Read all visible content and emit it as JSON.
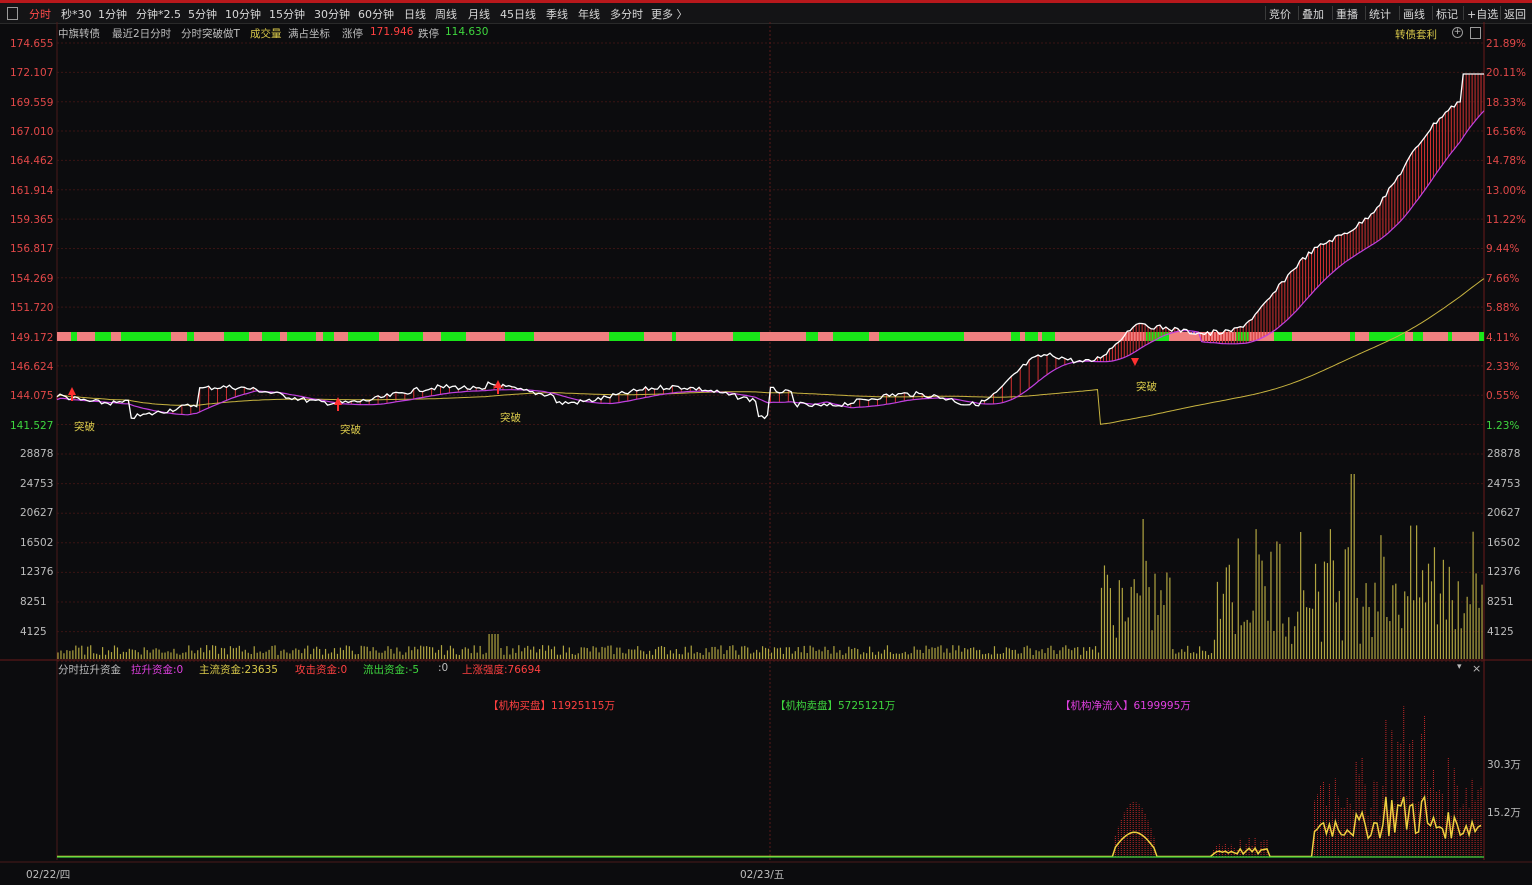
{
  "toolbar": {
    "left_tabs": [
      "分时",
      "秒*30",
      "1分钟",
      "分钟*2.5",
      "5分钟",
      "10分钟",
      "15分钟",
      "30分钟",
      "60分钟",
      "日线",
      "周线",
      "月线",
      "45日线",
      "季线",
      "年线",
      "多分时",
      "更多 〉"
    ],
    "right_tabs": [
      "竞价",
      "叠加",
      "重播",
      "统计",
      "画线",
      "标记",
      "+自选",
      "返回"
    ]
  },
  "header": {
    "name": "中旗转债",
    "period": "最近2日分时",
    "indicator": "分时突破做T",
    "volume_label": "成交量",
    "coord_label": "满占坐标",
    "limit_up_label": "涨停",
    "limit_up_value": "171.946",
    "limit_down_label": "跌停",
    "limit_down_value": "114.630",
    "right_tag": "转债套利"
  },
  "price_axis": {
    "left": [
      "174.655",
      "172.107",
      "169.559",
      "167.010",
      "164.462",
      "161.914",
      "159.365",
      "156.817",
      "154.269",
      "151.720",
      "149.172",
      "146.624",
      "144.075",
      "141.527"
    ],
    "right": [
      "21.89%",
      "20.11%",
      "18.33%",
      "16.56%",
      "14.78%",
      "13.00%",
      "11.22%",
      "9.44%",
      "7.66%",
      "5.88%",
      "4.11%",
      "2.33%",
      "0.55%",
      "1.23%"
    ]
  },
  "volume_axis": [
    "28878",
    "24753",
    "20627",
    "16502",
    "12376",
    "8251",
    "4125"
  ],
  "breakout_label": "突破",
  "lower_panel": {
    "title": "分时拉升资金",
    "items": [
      {
        "label": "拉升资金:",
        "value": "0",
        "color": "magenta"
      },
      {
        "label": "主流资金:",
        "value": "23635",
        "color": "yellow"
      },
      {
        "label": "攻击资金:",
        "value": "0",
        "color": "red"
      },
      {
        "label": "流出资金:",
        "value": "-5",
        "color": "green"
      },
      {
        "label": ":",
        "value": "0",
        "color": "grey"
      },
      {
        "label": "上涨强度:",
        "value": "76694",
        "color": "red"
      }
    ],
    "buy_label": "【机构买盘】11925115万",
    "sell_label": "【机构卖盘】5725121万",
    "net_label": "【机构净流入】6199995万",
    "axis": [
      "30.3万",
      "15.2万"
    ]
  },
  "dates": [
    "02/22/四",
    "02/23/五"
  ],
  "colors": {
    "red": "#e24848",
    "green": "#3ed63e",
    "yellow": "#d8c84a",
    "magenta": "#e040e0",
    "bg": "#0c0c0e"
  }
}
